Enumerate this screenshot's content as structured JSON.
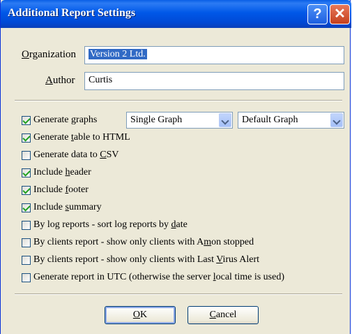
{
  "window": {
    "title": "Additional Report Settings"
  },
  "fields": {
    "organization": {
      "label_pre": "",
      "label_u": "O",
      "label_post": "rganization",
      "value": "Version 2 Ltd."
    },
    "author": {
      "label_pre": "",
      "label_u": "A",
      "label_post": "uthor",
      "value": "Curtis"
    }
  },
  "combos": {
    "graph_mode": "Single Graph",
    "graph_type": "Default Graph"
  },
  "options": [
    {
      "pre": "Generate ",
      "u": "g",
      "post": "raphs",
      "checked": true
    },
    {
      "pre": "Generate ",
      "u": "t",
      "post": "able to HTML",
      "checked": true
    },
    {
      "pre": "Generate data to ",
      "u": "C",
      "post": "SV",
      "checked": false
    },
    {
      "pre": "Include ",
      "u": "h",
      "post": "eader",
      "checked": true
    },
    {
      "pre": "Include ",
      "u": "f",
      "post": "ooter",
      "checked": true
    },
    {
      "pre": "Include ",
      "u": "s",
      "post": "ummary",
      "checked": true
    },
    {
      "pre": "By log reports - sort log reports by ",
      "u": "d",
      "post": "ate",
      "checked": false
    },
    {
      "pre": "By clients report - show only clients with A",
      "u": "m",
      "post": "on stopped",
      "checked": false
    },
    {
      "pre": "By clients report - show only clients with Last ",
      "u": "V",
      "post": "irus Alert",
      "checked": false
    },
    {
      "pre": "Generate report in UTC (otherwise the server ",
      "u": "l",
      "post": "ocal time is used)",
      "checked": false
    }
  ],
  "buttons": {
    "ok": {
      "u": "O",
      "post": "K"
    },
    "cancel": {
      "u": "C",
      "post": "ancel"
    }
  },
  "title_buttons": {
    "help": "?",
    "close": "✕"
  }
}
